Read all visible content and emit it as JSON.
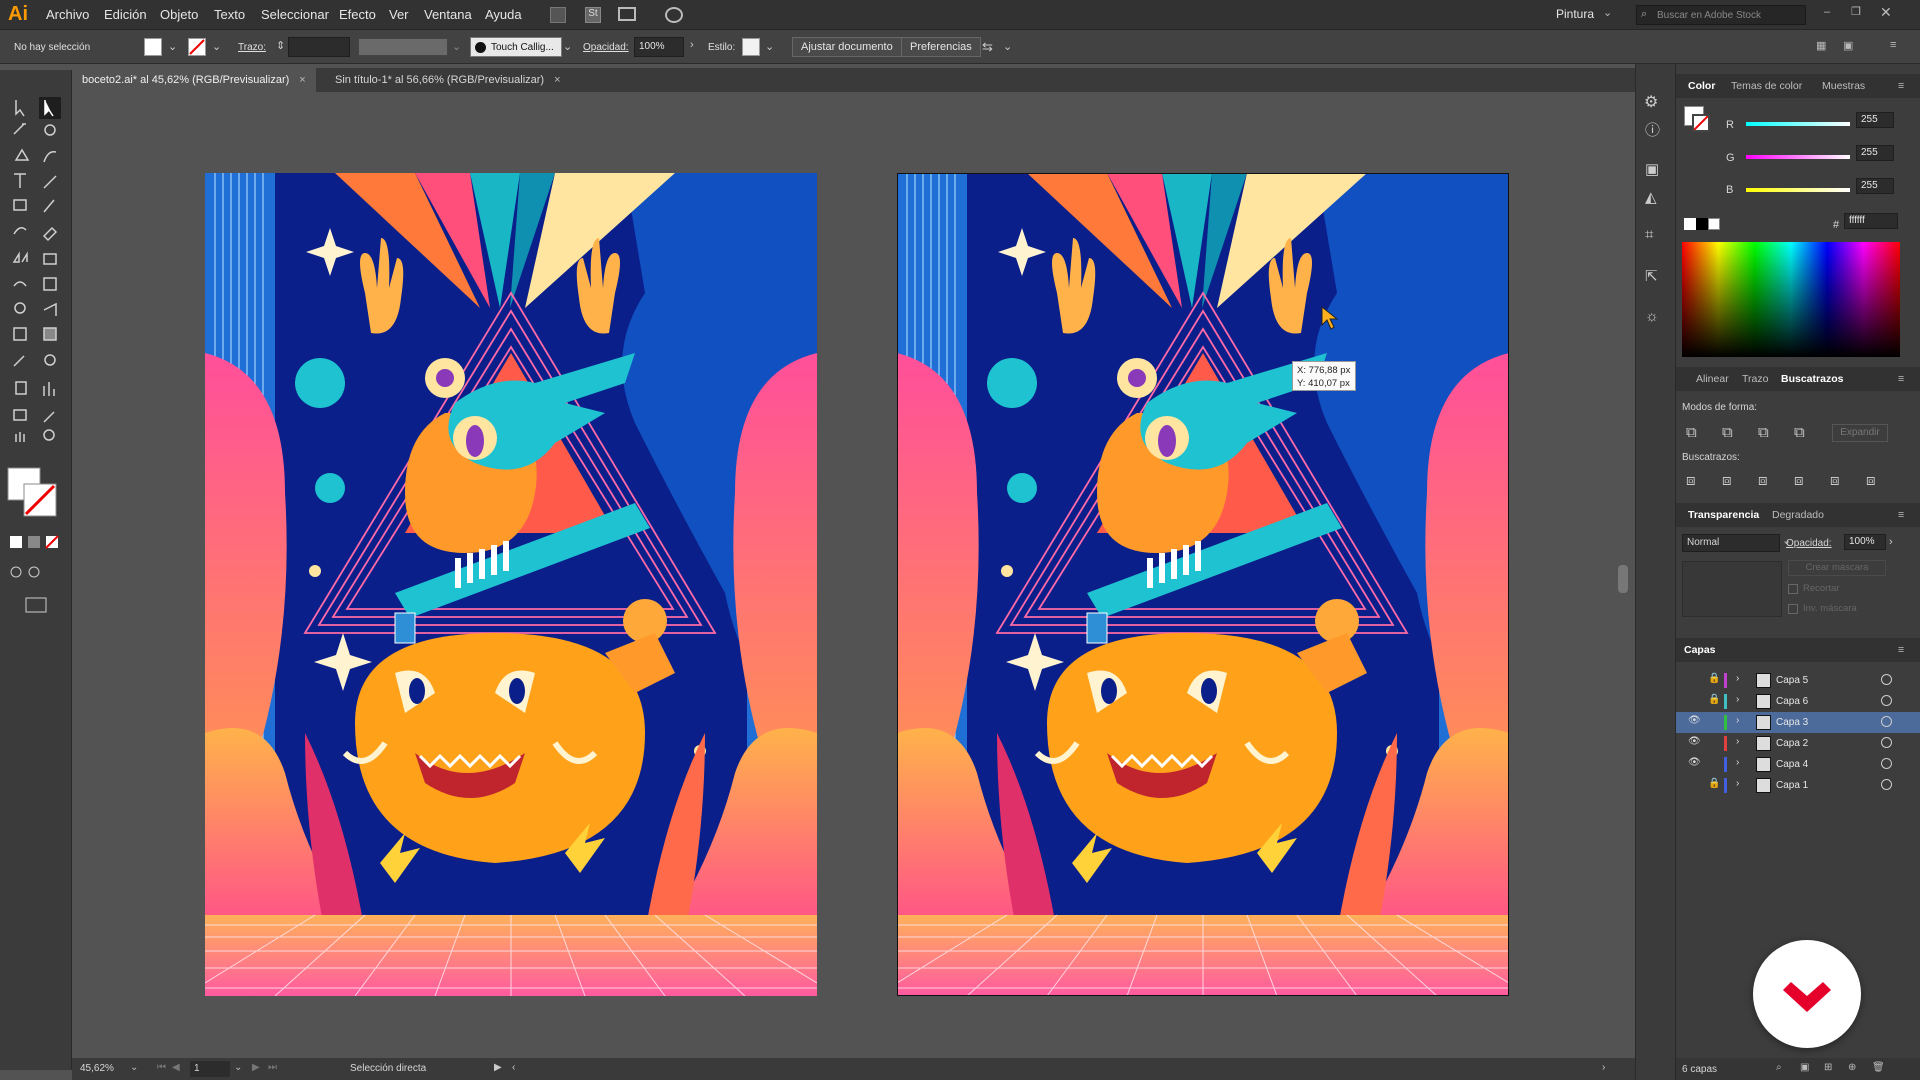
{
  "app": {
    "logo": "Ai"
  },
  "menu": [
    "Archivo",
    "Edición",
    "Objeto",
    "Texto",
    "Seleccionar",
    "Efecto",
    "Ver",
    "Ventana",
    "Ayuda"
  ],
  "workspace": "Pintura",
  "stock_search": {
    "placeholder": "Buscar en Adobe Stock"
  },
  "options": {
    "selection": "No hay selección",
    "stroke_label": "Trazo:",
    "brush": "Touch Callig...",
    "opacity_label": "Opacidad:",
    "opacity_value": "100%",
    "style_label": "Estilo:",
    "doc_setup": "Ajustar documento",
    "prefs": "Preferencias"
  },
  "tabs": [
    {
      "label": "boceto2.ai* al 45,62% (RGB/Previsualizar)",
      "close": "×"
    },
    {
      "label": "Sin título-1* al 56,66% (RGB/Previsualizar)",
      "close": "×"
    }
  ],
  "tooltip": {
    "x": "X: 776,88 px",
    "y": "Y: 410,07 px"
  },
  "status": {
    "zoom": "45,62%",
    "page": "1",
    "tool": "Selección directa"
  },
  "color_panel": {
    "tabs": [
      "Color",
      "Temas de color",
      "Muestras"
    ],
    "r_label": "R",
    "g_label": "G",
    "b_label": "B",
    "r": "255",
    "g": "255",
    "b": "255",
    "hex_label": "#",
    "hex": "ffffff"
  },
  "align_panel": {
    "tabs": [
      "Alinear",
      "Trazo",
      "Buscatrazos"
    ],
    "shape_modes": "Modos de forma:",
    "expand": "Expandir",
    "pathfinders": "Buscatrazos:"
  },
  "transparency_panel": {
    "tabs": [
      "Transparencia",
      "Degradado"
    ],
    "mode": "Normal",
    "opacity_label": "Opacidad:",
    "opacity": "100%",
    "make_mask": "Crear máscara",
    "clip": "Recortar",
    "invert": "Inv. máscara"
  },
  "layers_panel": {
    "title": "Capas",
    "layers": [
      {
        "name": "Capa 5",
        "color": "#c040d0",
        "visible": false,
        "locked": true
      },
      {
        "name": "Capa 6",
        "color": "#40c0c0",
        "visible": false,
        "locked": true
      },
      {
        "name": "Capa 3",
        "color": "#30c040",
        "visible": true,
        "locked": false
      },
      {
        "name": "Capa 2",
        "color": "#e04040",
        "visible": true,
        "locked": false
      },
      {
        "name": "Capa 4",
        "color": "#4060e0",
        "visible": true,
        "locked": false
      },
      {
        "name": "Capa 1",
        "color": "#4060e0",
        "visible": false,
        "locked": true
      }
    ],
    "footer": "6 capas"
  },
  "colors": {
    "accent": "#ff9a00",
    "selected_layer": "#4c6a9a",
    "brand_red": "#e4002b"
  }
}
